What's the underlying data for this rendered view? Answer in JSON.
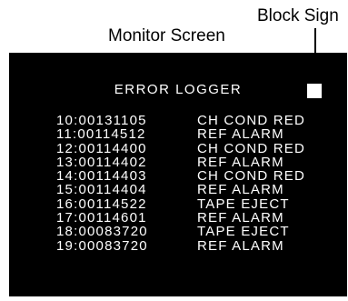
{
  "labels": {
    "monitor_screen": "Monitor Screen",
    "block_sign": "Block Sign"
  },
  "screen": {
    "title": "ERROR LOGGER",
    "rows": [
      {
        "code": "10:00131105",
        "message": "CH COND RED"
      },
      {
        "code": "11:00114512",
        "message": "REF ALARM"
      },
      {
        "code": "12:00114400",
        "message": "CH COND RED"
      },
      {
        "code": "13:00114402",
        "message": "REF ALARM"
      },
      {
        "code": "14:00114403",
        "message": "CH COND RED"
      },
      {
        "code": "15:00114404",
        "message": "REF ALARM"
      },
      {
        "code": "16:00114522",
        "message": "TAPE EJECT"
      },
      {
        "code": "17:00114601",
        "message": "REF ALARM"
      },
      {
        "code": "18:00083720",
        "message": "TAPE EJECT"
      },
      {
        "code": "19:00083720",
        "message": "REF ALARM"
      }
    ]
  },
  "colors": {
    "screen_background": "#000000",
    "screen_text": "#ffffff",
    "block_sign": "#ffffff"
  }
}
